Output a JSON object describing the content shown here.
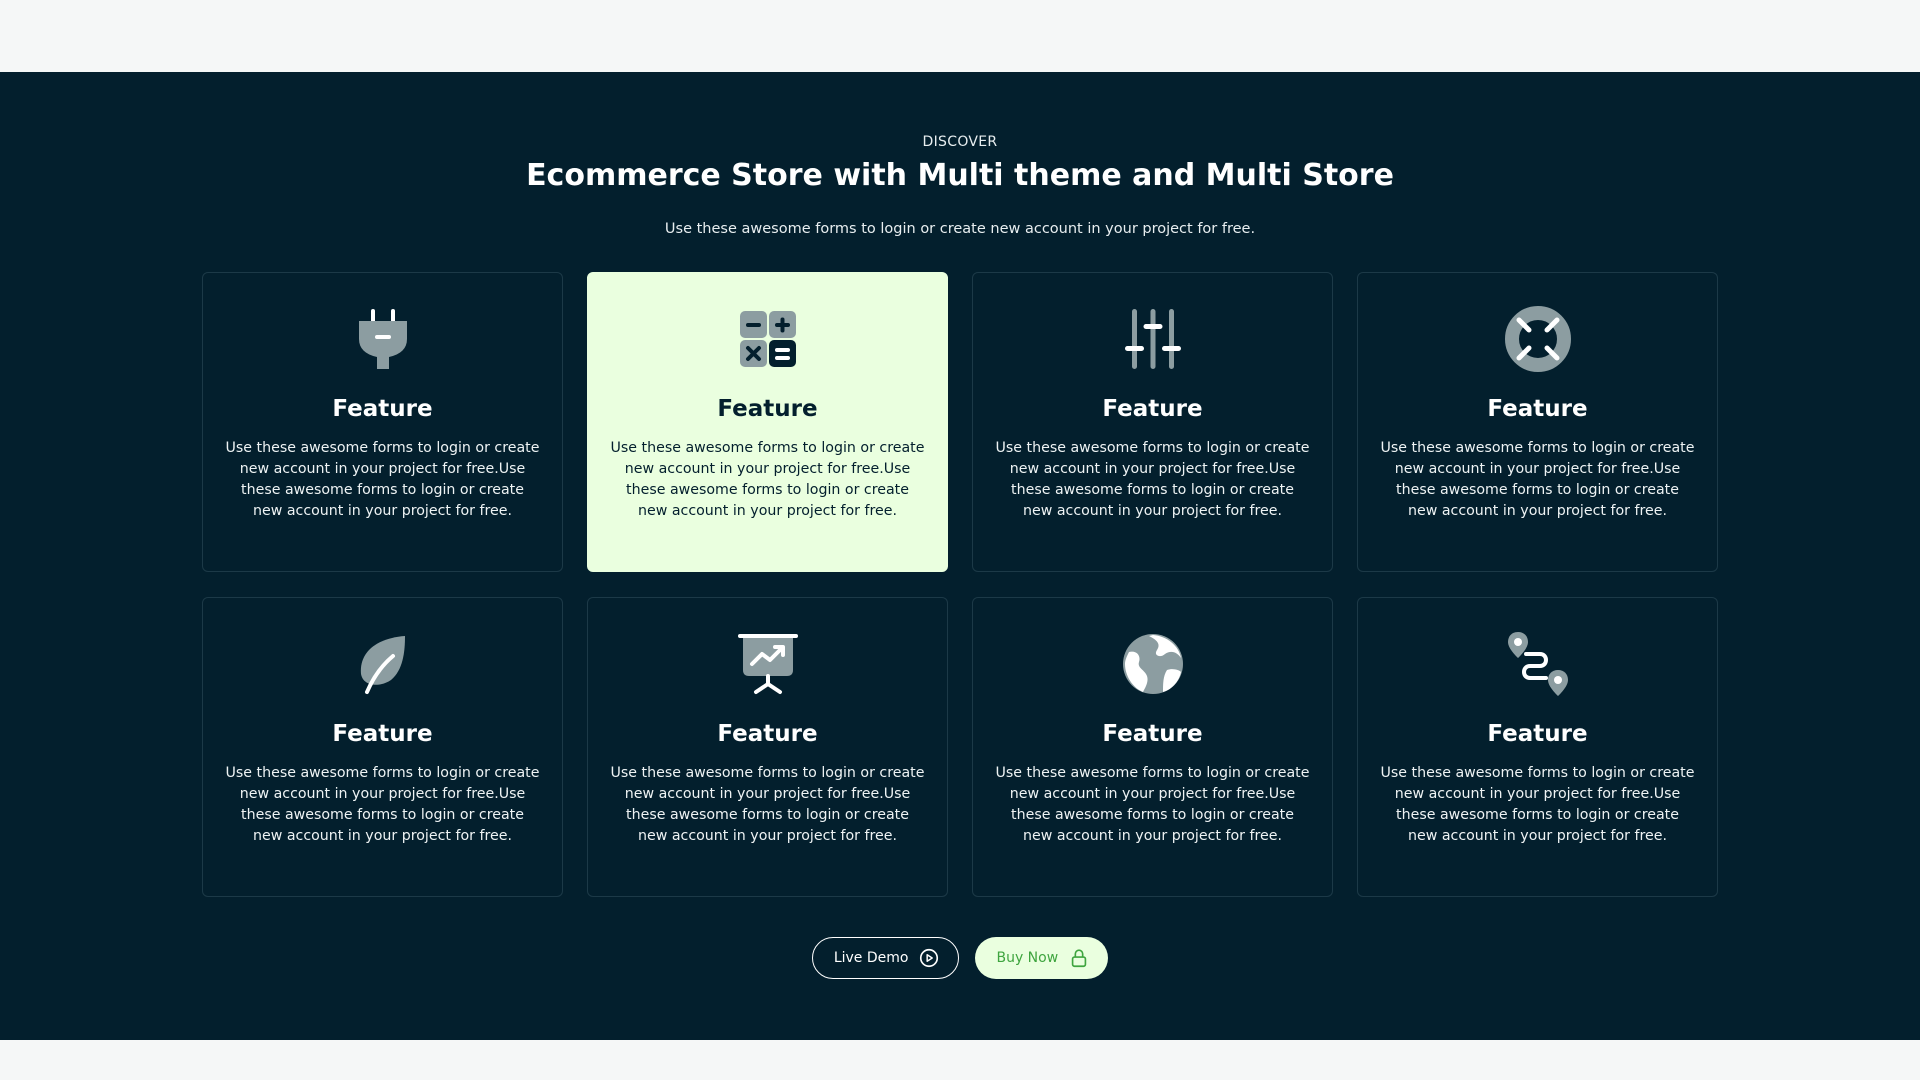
{
  "header": {
    "eyebrow": "DISCOVER",
    "title": "Ecommerce Store with Multi theme and Multi Store",
    "subtitle": "Use these awesome forms to login or create new account in your project for free."
  },
  "features": [
    {
      "icon": "plug-icon",
      "title": "Feature",
      "text": "Use these awesome forms to login or create new account in your project for free.Use these awesome forms to login or create new account in your project for free."
    },
    {
      "icon": "calculator-icon",
      "title": "Feature",
      "text": "Use these awesome forms to login or create new account in your project for free.Use these awesome forms to login or create new account in your project for free."
    },
    {
      "icon": "sliders-icon",
      "title": "Feature",
      "text": "Use these awesome forms to login or create new account in your project for free.Use these awesome forms to login or create new account in your project for free."
    },
    {
      "icon": "lifebuoy-icon",
      "title": "Feature",
      "text": "Use these awesome forms to login or create new account in your project for free.Use these awesome forms to login or create new account in your project for free."
    },
    {
      "icon": "leaf-icon",
      "title": "Feature",
      "text": "Use these awesome forms to login or create new account in your project for free.Use these awesome forms to login or create new account in your project for free."
    },
    {
      "icon": "presentation-chart-icon",
      "title": "Feature",
      "text": "Use these awesome forms to login or create new account in your project for free.Use these awesome forms to login or create new account in your project for free."
    },
    {
      "icon": "globe-icon",
      "title": "Feature",
      "text": "Use these awesome forms to login or create new account in your project for free.Use these awesome forms to login or create new account in your project for free."
    },
    {
      "icon": "route-icon",
      "title": "Feature",
      "text": "Use these awesome forms to login or create new account in your project for free.Use these awesome forms to login or create new account in your project for free."
    }
  ],
  "actions": {
    "live_demo": "Live Demo",
    "buy_now": "Buy Now"
  },
  "colors": {
    "section_bg": "#031f2d",
    "highlight_card": "#eaffdf",
    "buy_text": "#3fa53f"
  }
}
